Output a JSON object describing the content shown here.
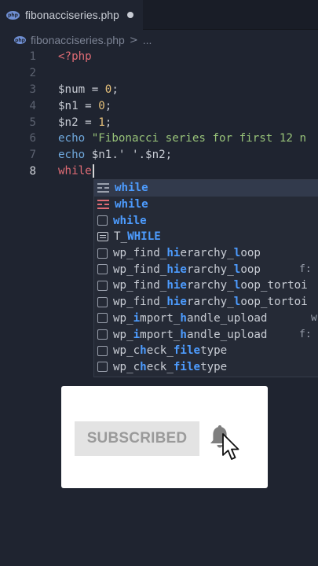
{
  "tab": {
    "file_icon": "php-file-icon",
    "file_icon_label": "php",
    "filename": "fibonacciseries.php",
    "unsaved_indicator": "dirty-dot"
  },
  "breadcrumb": {
    "filename": "fibonacciseries.php",
    "separator": ">",
    "more": "..."
  },
  "editor": {
    "line_numbers": [
      "1",
      "2",
      "3",
      "4",
      "5",
      "6",
      "7",
      "8"
    ],
    "active_line": "8",
    "lines": {
      "l1": "<?php",
      "l3_var": "$num",
      "l3_op": " = ",
      "l3_num": "0",
      "l3_end": ";",
      "l4_var": "$n1",
      "l4_op": " = ",
      "l4_num": "0",
      "l4_end": ";",
      "l5_var": "$n2",
      "l5_op": " = ",
      "l5_num": "1",
      "l5_end": ";",
      "l6_kw": "echo",
      "l6_str": " \"Fibonacci series for first 12 n",
      "l7_kw": "echo",
      "l7_rest": " $n1.' '.$n2;",
      "l8": "while"
    }
  },
  "suggestions": [
    {
      "pre": "",
      "hl": "while",
      "post": "",
      "icon": "snippet-icon",
      "right": ""
    },
    {
      "pre": "",
      "hl": "while",
      "post": "",
      "icon": "snippet-icon",
      "right": ""
    },
    {
      "pre": "",
      "hl": "while",
      "post": "",
      "icon": "text-icon",
      "right": ""
    },
    {
      "pre": "T_",
      "hl": "WHILE",
      "post": "",
      "icon": "keyword-icon",
      "right": ""
    },
    {
      "p1": "wp_find_",
      "h1": "hi",
      "p2": "erarchy_",
      "h2": "l",
      "p3": "oop",
      "icon": "text-icon",
      "right": ""
    },
    {
      "p1": "wp_find_",
      "h1": "hie",
      "p2": "rarchy_",
      "h2": "l",
      "p3": "oop",
      "icon": "text-icon",
      "right": "f:"
    },
    {
      "p1": "wp_find_",
      "h1": "hie",
      "p2": "rarchy_",
      "h2": "l",
      "p3": "oop_tortoi",
      "icon": "text-icon",
      "right": ""
    },
    {
      "p1": "wp_find_",
      "h1": "hie",
      "p2": "rarchy_",
      "h2": "l",
      "p3": "oop_tortoi",
      "icon": "text-icon",
      "right": ""
    },
    {
      "p1": "wp_",
      "h1": "i",
      "p2": "mport_",
      "h2": "h",
      "p3": "andle_upload",
      "icon": "text-icon",
      "right": "w"
    },
    {
      "p1": "wp_",
      "h1": "i",
      "p2": "mport_",
      "h2": "h",
      "p3": "andle_upload",
      "icon": "text-icon",
      "right": "f:"
    },
    {
      "p1": "wp_c",
      "h1": "h",
      "p2": "eck_",
      "h2": "file",
      "p3": "type",
      "icon": "text-icon",
      "right": ""
    },
    {
      "p1": "wp_c",
      "h1": "h",
      "p2": "eck_",
      "h2": "file",
      "p3": "type",
      "icon": "text-icon",
      "right": ""
    }
  ],
  "subscribe": {
    "button_label": "SUBSCRIBED",
    "bell_icon": "bell-icon",
    "cursor_icon": "mouse-pointer-icon"
  },
  "colors": {
    "editor_bg": "#1f2430",
    "keyword": "#6fa8dc",
    "string": "#98c379",
    "number": "#e5c07b",
    "tag": "#e06c75",
    "match_highlight": "#4d9cff"
  }
}
